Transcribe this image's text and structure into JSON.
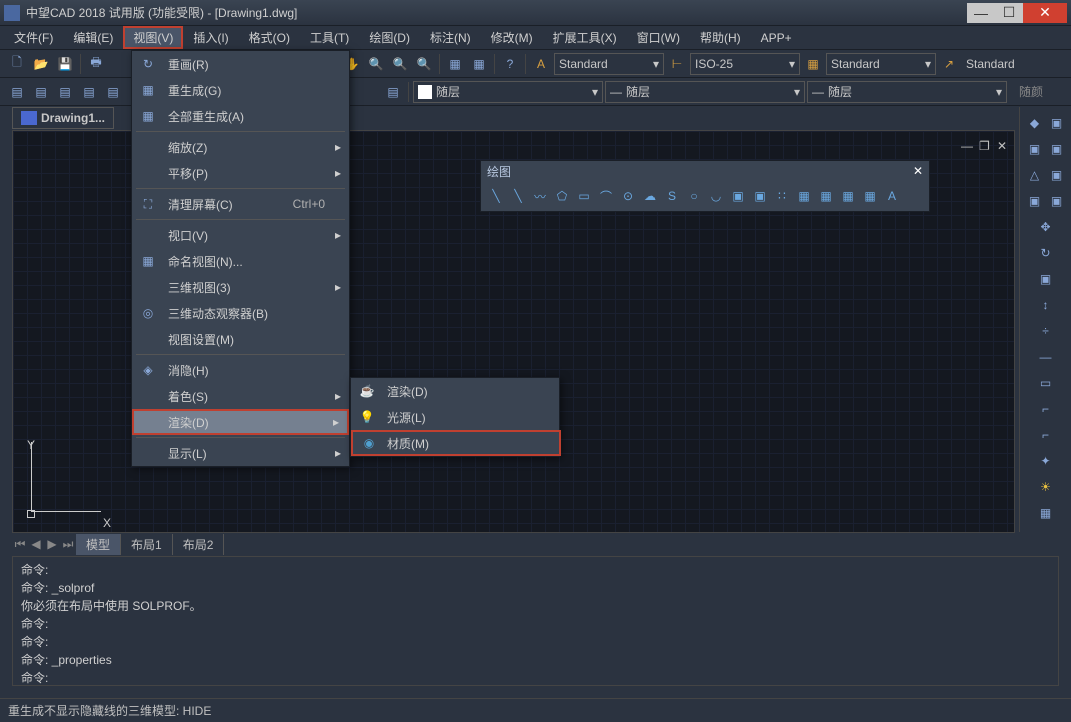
{
  "title": "中望CAD 2018 试用版 (功能受限) - [Drawing1.dwg]",
  "menu": {
    "file": "文件(F)",
    "edit": "编辑(E)",
    "view": "视图(V)",
    "insert": "插入(I)",
    "format": "格式(O)",
    "tools": "工具(T)",
    "draw": "绘图(D)",
    "dimension": "标注(N)",
    "modify": "修改(M)",
    "express": "扩展工具(X)",
    "window": "窗口(W)",
    "help": "帮助(H)",
    "app": "APP+"
  },
  "viewmenu": {
    "redraw": "重画(R)",
    "regen": "重生成(G)",
    "regenall": "全部重生成(A)",
    "zoom": "缩放(Z)",
    "pan": "平移(P)",
    "cleanscreen": "清理屏幕(C)",
    "cleanscreen_sc": "Ctrl+0",
    "viewport": "视口(V)",
    "namedview": "命名视图(N)...",
    "view3d": "三维视图(3)",
    "orbit3d": "三维动态观察器(B)",
    "viewset": "视图设置(M)",
    "hide": "消隐(H)",
    "shade": "着色(S)",
    "render": "渲染(D)",
    "display": "显示(L)"
  },
  "rendermenu": {
    "render": "渲染(D)",
    "light": "光源(L)",
    "material": "材质(M)"
  },
  "doc": {
    "tab": "Drawing1..."
  },
  "toolbar": {
    "standard": "Standard",
    "iso25": "ISO-25"
  },
  "layer": {
    "label": "随层"
  },
  "layer_right": "随颜",
  "floatpanel": {
    "title": "绘图"
  },
  "layout": {
    "model": "模型",
    "l1": "布局1",
    "l2": "布局2"
  },
  "cmd": {
    "l1": "命令:",
    "l2": "命令: _solprof",
    "l3": "你必须在布局中使用 SOLPROF。",
    "l4": "命令:",
    "l5": "命令:",
    "l6": "命令: _properties",
    "l7": "命令:"
  },
  "status": "重生成不显示隐藏线的三维模型: HIDE",
  "axis": {
    "x": "X",
    "y": "Y"
  }
}
